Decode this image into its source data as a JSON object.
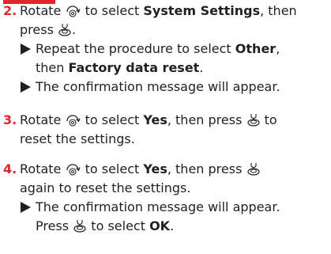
{
  "icons": {
    "dial": "dial-rotate-icon",
    "press": "press-knob-icon"
  },
  "colors": {
    "step_number": "#e3262b",
    "header_bar": "#e3262b",
    "text": "#231f20"
  },
  "steps": [
    {
      "number": "2.",
      "line1_before": "Rotate",
      "line1_mid": "to select",
      "line1_bold": "System Settings",
      "line1_after": ", then",
      "line2": "press",
      "line2_after": ".",
      "subs": [
        {
          "a": "Repeat the procedure to select ",
          "b_bold": "Other",
          "c": ",",
          "d": "then ",
          "e_bold": "Factory data reset",
          "f": "."
        },
        {
          "text": "The confirmation message will appear."
        }
      ]
    },
    {
      "number": "3.",
      "line1_before": "Rotate",
      "line1_mid": "to select",
      "line1_bold": "Yes",
      "line1_after": ", then press",
      "line1_end": "to",
      "line2": "reset the settings."
    },
    {
      "number": "4.",
      "line1_before": "Rotate",
      "line1_mid": "to select",
      "line1_bold": "Yes",
      "line1_after": ", then press",
      "line2": "again to reset the settings.",
      "subs": [
        {
          "text": "The confirmation message will appear."
        },
        {
          "a": "Press",
          "b": "to select ",
          "c_bold": "OK",
          "d": "."
        }
      ]
    }
  ]
}
